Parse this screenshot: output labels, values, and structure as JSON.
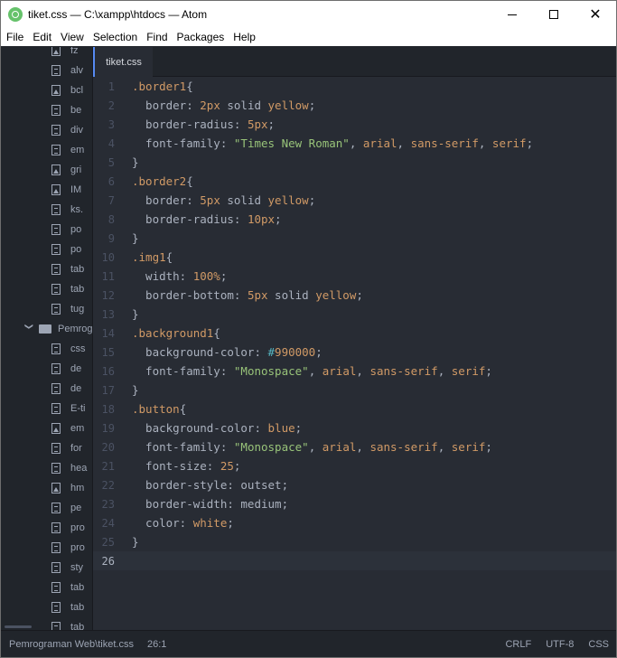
{
  "window": {
    "title": "tiket.css — C:\\xampp\\htdocs — Atom"
  },
  "menu": [
    "File",
    "Edit",
    "View",
    "Selection",
    "Find",
    "Packages",
    "Help"
  ],
  "tree": {
    "items": [
      {
        "type": "image",
        "label": "fz"
      },
      {
        "type": "text",
        "label": "alv"
      },
      {
        "type": "image",
        "label": "bcl"
      },
      {
        "type": "text",
        "label": "be"
      },
      {
        "type": "text",
        "label": "div"
      },
      {
        "type": "text",
        "label": "em"
      },
      {
        "type": "image",
        "label": "gri"
      },
      {
        "type": "image",
        "label": "IM"
      },
      {
        "type": "text",
        "label": "ks."
      },
      {
        "type": "text",
        "label": "po"
      },
      {
        "type": "text",
        "label": "po"
      },
      {
        "type": "text",
        "label": "tab"
      },
      {
        "type": "text",
        "label": "tab"
      },
      {
        "type": "text",
        "label": "tug"
      },
      {
        "type": "folder",
        "label": "Pemrog"
      },
      {
        "type": "text",
        "label": "css"
      },
      {
        "type": "text",
        "label": "de"
      },
      {
        "type": "text",
        "label": "de"
      },
      {
        "type": "text",
        "label": "E-ti"
      },
      {
        "type": "image",
        "label": "em"
      },
      {
        "type": "text",
        "label": "for"
      },
      {
        "type": "text",
        "label": "hea"
      },
      {
        "type": "image",
        "label": "hm"
      },
      {
        "type": "text",
        "label": "pe"
      },
      {
        "type": "text",
        "label": "pro"
      },
      {
        "type": "text",
        "label": "pro"
      },
      {
        "type": "text",
        "label": "sty"
      },
      {
        "type": "text",
        "label": "tab"
      },
      {
        "type": "text",
        "label": "tab"
      },
      {
        "type": "text",
        "label": "tab"
      }
    ]
  },
  "tab": {
    "label": "tiket.css"
  },
  "editor": {
    "cursor_line": 26,
    "lines": [
      [
        [
          "c-sel",
          ".border1"
        ],
        [
          "c-punct",
          "{"
        ]
      ],
      [
        [
          "c-prop",
          "  border: "
        ],
        [
          "c-num",
          "2px"
        ],
        [
          "c-prop",
          " solid "
        ],
        [
          "c-kw",
          "yellow"
        ],
        [
          "c-punct",
          ";"
        ]
      ],
      [
        [
          "c-prop",
          "  border-radius: "
        ],
        [
          "c-num",
          "5px"
        ],
        [
          "c-punct",
          ";"
        ]
      ],
      [
        [
          "c-prop",
          "  font-family: "
        ],
        [
          "c-str",
          "\"Times New Roman\""
        ],
        [
          "c-punct",
          ", "
        ],
        [
          "c-kw",
          "arial"
        ],
        [
          "c-punct",
          ", "
        ],
        [
          "c-kw",
          "sans-serif"
        ],
        [
          "c-punct",
          ", "
        ],
        [
          "c-kw",
          "serif"
        ],
        [
          "c-punct",
          ";"
        ]
      ],
      [
        [
          "c-punct",
          "}"
        ]
      ],
      [
        [
          "c-sel",
          ".border2"
        ],
        [
          "c-punct",
          "{"
        ]
      ],
      [
        [
          "c-prop",
          "  border: "
        ],
        [
          "c-num",
          "5px"
        ],
        [
          "c-prop",
          " solid "
        ],
        [
          "c-kw",
          "yellow"
        ],
        [
          "c-punct",
          ";"
        ]
      ],
      [
        [
          "c-prop",
          "  border-radius: "
        ],
        [
          "c-num",
          "10px"
        ],
        [
          "c-punct",
          ";"
        ]
      ],
      [
        [
          "c-punct",
          "}"
        ]
      ],
      [
        [
          "c-sel",
          ".img1"
        ],
        [
          "c-punct",
          "{"
        ]
      ],
      [
        [
          "c-prop",
          "  width: "
        ],
        [
          "c-num",
          "100%"
        ],
        [
          "c-punct",
          ";"
        ]
      ],
      [
        [
          "c-prop",
          "  border-bottom: "
        ],
        [
          "c-num",
          "5px"
        ],
        [
          "c-prop",
          " solid "
        ],
        [
          "c-kw",
          "yellow"
        ],
        [
          "c-punct",
          ";"
        ]
      ],
      [
        [
          "c-punct",
          "}"
        ]
      ],
      [
        [
          "c-sel",
          ".background1"
        ],
        [
          "c-punct",
          "{"
        ]
      ],
      [
        [
          "c-prop",
          "  background-color: "
        ],
        [
          "c-hash",
          "#"
        ],
        [
          "c-num",
          "990000"
        ],
        [
          "c-punct",
          ";"
        ]
      ],
      [
        [
          "c-prop",
          "  font-family: "
        ],
        [
          "c-str",
          "\"Monospace\""
        ],
        [
          "c-punct",
          ", "
        ],
        [
          "c-kw",
          "arial"
        ],
        [
          "c-punct",
          ", "
        ],
        [
          "c-kw",
          "sans-serif"
        ],
        [
          "c-punct",
          ", "
        ],
        [
          "c-kw",
          "serif"
        ],
        [
          "c-punct",
          ";"
        ]
      ],
      [
        [
          "c-punct",
          "}"
        ]
      ],
      [
        [
          "c-sel",
          ".button"
        ],
        [
          "c-punct",
          "{"
        ]
      ],
      [
        [
          "c-prop",
          "  background-color: "
        ],
        [
          "c-kw",
          "blue"
        ],
        [
          "c-punct",
          ";"
        ]
      ],
      [
        [
          "c-prop",
          "  font-family: "
        ],
        [
          "c-str",
          "\"Monospace\""
        ],
        [
          "c-punct",
          ", "
        ],
        [
          "c-kw",
          "arial"
        ],
        [
          "c-punct",
          ", "
        ],
        [
          "c-kw",
          "sans-serif"
        ],
        [
          "c-punct",
          ", "
        ],
        [
          "c-kw",
          "serif"
        ],
        [
          "c-punct",
          ";"
        ]
      ],
      [
        [
          "c-prop",
          "  font-size: "
        ],
        [
          "c-num",
          "25"
        ],
        [
          "c-punct",
          ";"
        ]
      ],
      [
        [
          "c-prop",
          "  border-style: outset;"
        ]
      ],
      [
        [
          "c-prop",
          "  border-width: medium;"
        ]
      ],
      [
        [
          "c-prop",
          "  color: "
        ],
        [
          "c-kw",
          "white"
        ],
        [
          "c-punct",
          ";"
        ]
      ],
      [
        [
          "c-punct",
          "}"
        ]
      ],
      []
    ]
  },
  "status": {
    "path": "Pemrograman Web\\tiket.css",
    "cursor": "26:1",
    "line_ending": "CRLF",
    "encoding": "UTF-8",
    "grammar": "CSS"
  }
}
